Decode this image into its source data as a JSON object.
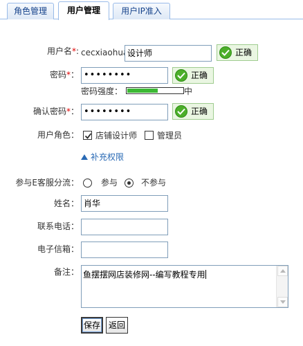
{
  "tabs": [
    {
      "label": "角色管理",
      "active": false
    },
    {
      "label": "用户管理",
      "active": true
    },
    {
      "label": "用户IP准入",
      "active": false
    }
  ],
  "form": {
    "username": {
      "label": "用户名",
      "prefix": "cecxiaohua:",
      "value": "设计师",
      "status": "正确"
    },
    "password": {
      "label": "密码",
      "value": "••••••••",
      "status": "正确"
    },
    "strength": {
      "label": "密码强度：",
      "level": "中",
      "fill_percent": 55
    },
    "confirm": {
      "label": "确认密码",
      "value": "••••••••",
      "status": "正确"
    },
    "roles": {
      "label": "用户角色：",
      "options": [
        {
          "label": "店铺设计师",
          "checked": true
        },
        {
          "label": "管理员",
          "checked": false
        }
      ]
    },
    "more_permissions": "补充权限",
    "service": {
      "label": "参与E客服分流：",
      "options": [
        {
          "label": "参与",
          "selected": false
        },
        {
          "label": "不参与",
          "selected": true
        }
      ]
    },
    "name": {
      "label": "姓名：",
      "value": "肖华"
    },
    "phone": {
      "label": "联系电话：",
      "value": ""
    },
    "email": {
      "label": "电子信箱：",
      "value": ""
    },
    "remark": {
      "label": "备注：",
      "value": "鱼摆摆网店装修网--编写教程专用"
    }
  },
  "buttons": {
    "save": "保存",
    "back": "返回"
  },
  "colors": {
    "ok_green": "#4caf2a",
    "required_red": "#e00000",
    "link_blue": "#2a6ab5",
    "tab_border": "#99bbe8"
  }
}
